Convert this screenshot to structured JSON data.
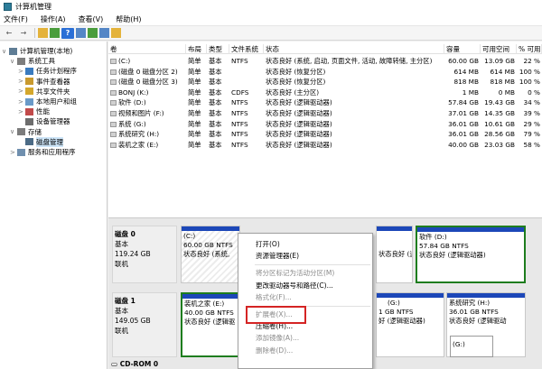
{
  "window": {
    "title": "计算机管理"
  },
  "menu": [
    "文件(F)",
    "操作(A)",
    "查看(V)",
    "帮助(H)"
  ],
  "tree": [
    {
      "label": "计算机管理(本地)",
      "depth": 0,
      "expander": "∨"
    },
    {
      "label": "系统工具",
      "depth": 1,
      "expander": "∨"
    },
    {
      "label": "任务计划程序",
      "depth": 2,
      "expander": ">"
    },
    {
      "label": "事件查看器",
      "depth": 2,
      "expander": ">"
    },
    {
      "label": "共享文件夹",
      "depth": 2,
      "expander": ">"
    },
    {
      "label": "本地用户和组",
      "depth": 2,
      "expander": ">"
    },
    {
      "label": "性能",
      "depth": 2,
      "expander": ">"
    },
    {
      "label": "设备管理器",
      "depth": 2,
      "expander": ""
    },
    {
      "label": "存储",
      "depth": 1,
      "expander": "∨"
    },
    {
      "label": "磁盘管理",
      "depth": 2,
      "expander": "",
      "selected": true
    },
    {
      "label": "服务和应用程序",
      "depth": 1,
      "expander": ">"
    }
  ],
  "columns": [
    "卷",
    "布局",
    "类型",
    "文件系统",
    "状态",
    "容量",
    "可用空间",
    "% 可用"
  ],
  "rows": [
    [
      "(C:)",
      "简单",
      "基本",
      "NTFS",
      "状态良好 (系统, 启动, 页面文件, 活动, 故障转储, 主分区)",
      "60.00 GB",
      "13.09 GB",
      "22 %"
    ],
    [
      "(磁盘 0 磁盘分区 2)",
      "简单",
      "基本",
      "",
      "状态良好 (恢复分区)",
      "614 MB",
      "614 MB",
      "100 %"
    ],
    [
      "(磁盘 0 磁盘分区 3)",
      "简单",
      "基本",
      "",
      "状态良好 (恢复分区)",
      "818 MB",
      "818 MB",
      "100 %"
    ],
    [
      "BONJ (K:)",
      "简单",
      "基本",
      "CDFS",
      "状态良好 (主分区)",
      "1 MB",
      "0 MB",
      "0 %"
    ],
    [
      "软件 (D:)",
      "简单",
      "基本",
      "NTFS",
      "状态良好 (逻辑驱动器)",
      "57.84 GB",
      "19.43 GB",
      "34 %"
    ],
    [
      "视频和图片 (F:)",
      "简单",
      "基本",
      "NTFS",
      "状态良好 (逻辑驱动器)",
      "37.01 GB",
      "14.35 GB",
      "39 %"
    ],
    [
      "系统 (G:)",
      "简单",
      "基本",
      "NTFS",
      "状态良好 (逻辑驱动器)",
      "36.01 GB",
      "10.61 GB",
      "29 %"
    ],
    [
      "系统研究 (H:)",
      "简单",
      "基本",
      "NTFS",
      "状态良好 (逻辑驱动器)",
      "36.01 GB",
      "28.56 GB",
      "79 %"
    ],
    [
      "装机之家 (E:)",
      "简单",
      "基本",
      "NTFS",
      "状态良好 (逻辑驱动器)",
      "40.00 GB",
      "23.03 GB",
      "58 %"
    ]
  ],
  "disk0": {
    "name": "磁盘 0",
    "type": "基本",
    "size": "119.24 GB",
    "status": "联机",
    "c": {
      "name": "(C:)",
      "size": "60.00 GB NTFS",
      "status": "状态良好 (系统,"
    },
    "mid": {
      "status": "状态良好 (逻辑驱动器)"
    },
    "d": {
      "name": "软件 (D:)",
      "size": "57.84 GB NTFS",
      "status": "状态良好 (逻辑驱动器)"
    }
  },
  "disk1": {
    "name": "磁盘 1",
    "type": "基本",
    "size": "149.05 GB",
    "status": "联机",
    "e": {
      "name": "装机之家 (E:)",
      "size": "40.00 GB NTFS",
      "status": "状态良好 (逻辑驱"
    },
    "g": {
      "name": "(G:)",
      "size": "1 GB NTFS",
      "status": "好 (逻辑驱动器)"
    },
    "h": {
      "name": "系统研究 (H:)",
      "size": "36.01 GB NTFS",
      "status": "状态良好 (逻辑驱动"
    }
  },
  "cdrom": {
    "name": "CD-ROM 0"
  },
  "g2": {
    "name": "(G:)"
  },
  "context_menu": [
    {
      "label": "打开(O)",
      "disabled": false
    },
    {
      "label": "资源管理器(E)",
      "disabled": false
    },
    {
      "sep": true
    },
    {
      "label": "将分区标记为活动分区(M)",
      "disabled": true
    },
    {
      "label": "更改驱动器号和路径(C)...",
      "disabled": false
    },
    {
      "label": "格式化(F)...",
      "disabled": true
    },
    {
      "sep": true
    },
    {
      "label": "扩展卷(X)...",
      "disabled": true
    },
    {
      "label": "压缩卷(H)...",
      "disabled": false
    },
    {
      "label": "添加镜像(A)...",
      "disabled": true
    },
    {
      "label": "删除卷(D)...",
      "disabled": true
    }
  ]
}
